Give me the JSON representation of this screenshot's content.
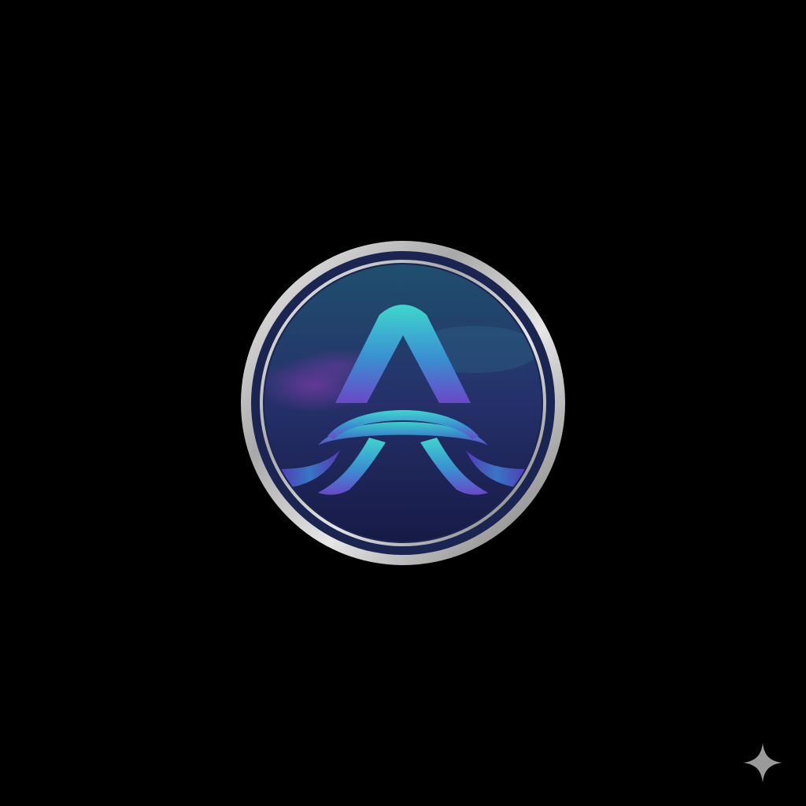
{
  "background_color": "#000000",
  "emblem": {
    "glyph": "A",
    "icon": "letter-a-wave-logo-icon",
    "colors": {
      "ring_light": "#f2f2f2",
      "ring_mid": "#a9a9a9",
      "ring_dark": "#6f6f6f",
      "disc_top": "#1f4f6e",
      "disc_mid": "#25306a",
      "disc_bottom": "#161a45",
      "nebula": "#7a3aa8",
      "glyph_top": "#3fd6cf",
      "glyph_mid": "#3a8fd0",
      "glyph_bottom": "#6a48c8"
    }
  },
  "sparkle": {
    "icon": "sparkle-star-icon",
    "color": "#9a9a9a"
  }
}
